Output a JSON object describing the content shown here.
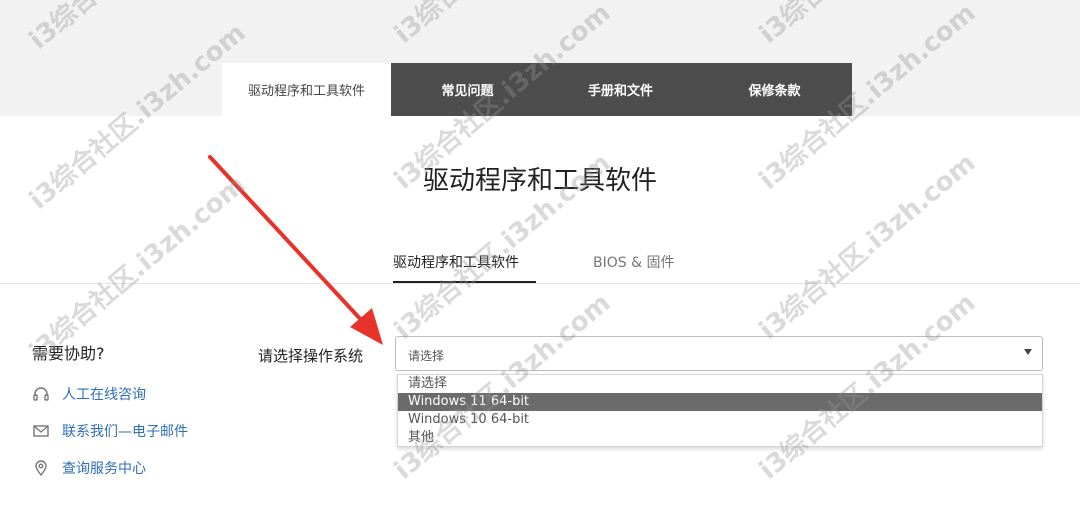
{
  "top_tabs": [
    {
      "label": "驱动程序和工具软件",
      "active": true
    },
    {
      "label": "常见问题",
      "active": false
    },
    {
      "label": "手册和文件",
      "active": false
    },
    {
      "label": "保修条款",
      "active": false
    }
  ],
  "section_title": "驱动程序和工具软件",
  "sub_tabs": [
    {
      "label": "驱动程序和工具软件",
      "active": true
    },
    {
      "label": "BIOS & 固件",
      "active": false
    }
  ],
  "help": {
    "title": "需要协助?",
    "items": [
      {
        "label": "人工在线咨询",
        "icon": "headset-icon"
      },
      {
        "label": "联系我们—电子邮件",
        "icon": "mail-icon"
      },
      {
        "label": "查询服务中心",
        "icon": "location-pin-icon"
      }
    ]
  },
  "os_select": {
    "label": "请选择操作系统",
    "value": "请选择",
    "options": [
      "请选择",
      "Windows 11 64-bit",
      "Windows 10 64-bit",
      "其他"
    ],
    "highlighted": "Windows 11 64-bit"
  },
  "watermark": "i3综合社区.i3zh.com",
  "colors": {
    "tab_dark": "#4d4d4d",
    "link_blue": "#2e6fb7",
    "arrow_red": "#e8332b",
    "option_highlight": "#6b6b6b"
  }
}
